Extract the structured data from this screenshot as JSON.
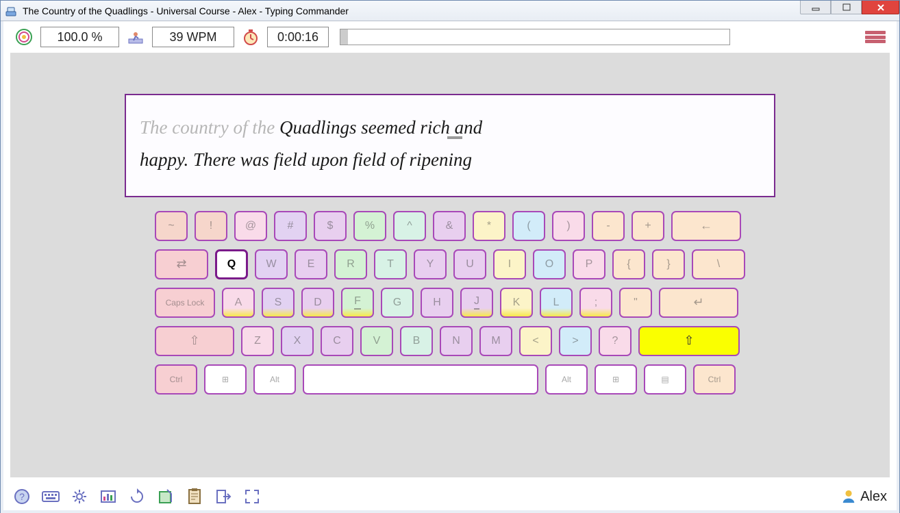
{
  "window": {
    "title": "The Country of the Quadlings - Universal Course - Alex - Typing Commander"
  },
  "stats": {
    "accuracy": "100.0 %",
    "speed": "39 WPM",
    "time": "0:00:16",
    "progress_pct": 2
  },
  "text": {
    "typed": "The country of the ",
    "current_char": "Q",
    "remaining_line1": "uadlings seemed rich and",
    "line2": "happy. There was field upon field of ripening"
  },
  "keyboard": {
    "row1": [
      "~",
      "!",
      "@",
      "#",
      "$",
      "%",
      "^",
      "&",
      "*",
      "(",
      ")",
      "-",
      "+"
    ],
    "backspace": "←",
    "tab": "⇄",
    "row2": [
      "Q",
      "W",
      "E",
      "R",
      "T",
      "Y",
      "U",
      "I",
      "O",
      "P",
      "{",
      "}"
    ],
    "backslash": "\\",
    "capslock": "Caps Lock",
    "row3": [
      "A",
      "S",
      "D",
      "F",
      "G",
      "H",
      "J",
      "K",
      "L",
      ";",
      "\""
    ],
    "enter": "↵",
    "lshift": "⇧",
    "row4": [
      "Z",
      "X",
      "C",
      "V",
      "B",
      "N",
      "M",
      "<",
      ">",
      "?"
    ],
    "rshift": "⇧",
    "bottom": {
      "ctrl": "Ctrl",
      "win": "⊞",
      "alt": "Alt",
      "altgr": "Alt",
      "menu": "▤"
    }
  },
  "user": {
    "name": "Alex"
  }
}
